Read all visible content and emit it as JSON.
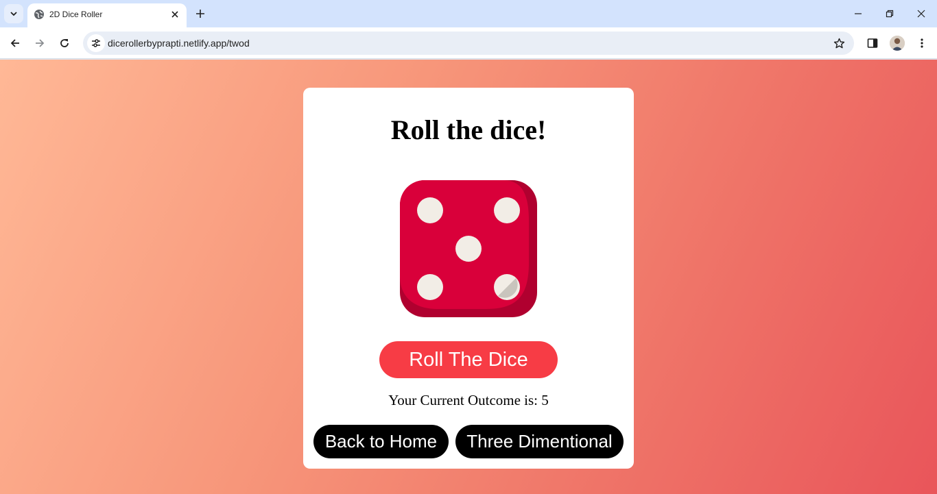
{
  "browser": {
    "tab": {
      "title": "2D Dice Roller",
      "favicon": "globe-icon"
    },
    "address_bar": {
      "url": "dicerollerbyprapti.netlify.app/twod"
    },
    "icons": {
      "tab_list": "chevron-down-icon",
      "close_tab": "close-icon",
      "new_tab": "plus-icon",
      "back": "arrow-left-icon",
      "forward": "arrow-right-icon",
      "reload": "reload-icon",
      "site_info": "tune-icon",
      "bookmark": "star-icon",
      "side_panel": "side-panel-icon",
      "profile": "avatar",
      "menu": "kebab-menu-icon",
      "minimize": "minimize-icon",
      "restore": "restore-icon",
      "close_window": "close-icon"
    }
  },
  "page": {
    "background_colors": [
      "#ffb896",
      "#e9555a"
    ],
    "heading": "Roll the dice!",
    "dice": {
      "face_value": 5,
      "body_color": "#d9003a",
      "shade_color": "#b0002f",
      "pip_color": "#f2ede6"
    },
    "roll_button": {
      "label": "Roll The Dice",
      "color": "#f73c45"
    },
    "outcome_text": "Your Current Outcome is: 5",
    "nav_buttons": {
      "home_label": "Back to Home",
      "three_d_label": "Three Dimentional"
    }
  }
}
